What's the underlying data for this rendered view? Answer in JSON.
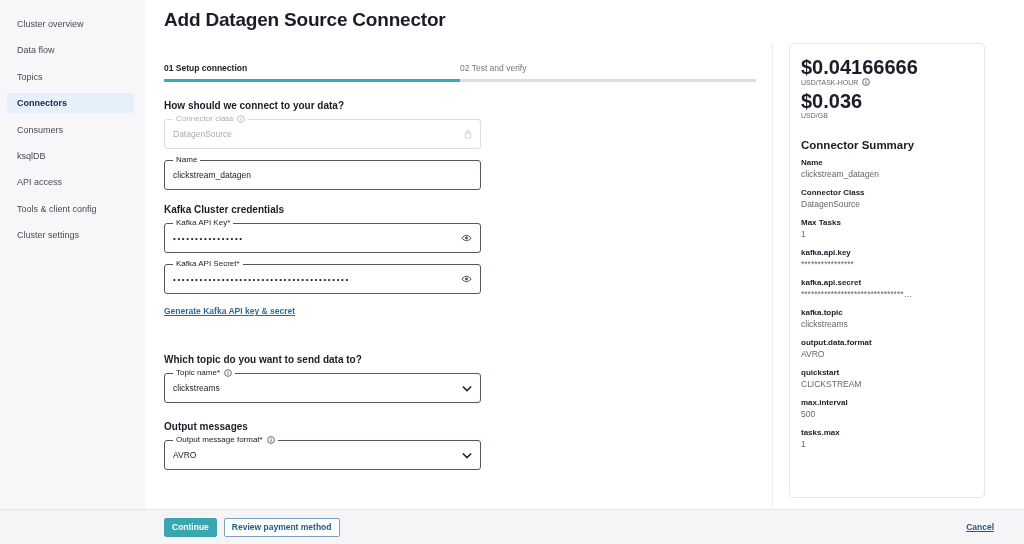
{
  "sidebar": {
    "items": [
      {
        "label": "Cluster overview",
        "selected": false
      },
      {
        "label": "Data flow",
        "selected": false
      },
      {
        "label": "Topics",
        "selected": false
      },
      {
        "label": "Connectors",
        "selected": true
      },
      {
        "label": "Consumers",
        "selected": false
      },
      {
        "label": "ksqlDB",
        "selected": false
      },
      {
        "label": "API access",
        "selected": false
      },
      {
        "label": "Tools & client config",
        "selected": false
      },
      {
        "label": "Cluster settings",
        "selected": false
      }
    ]
  },
  "page": {
    "title": "Add Datagen Source Connector"
  },
  "steps": {
    "items": [
      {
        "label": "01 Setup connection",
        "selected": true
      },
      {
        "label": "02 Test and verify",
        "selected": false
      }
    ],
    "level": 0.5
  },
  "form": {
    "sections": [
      {
        "heading": "How should we connect to your data?",
        "fields": [
          {
            "kind": "disabled",
            "label": "Connector class",
            "info": true,
            "value": "DatagenSource"
          },
          {
            "kind": "text",
            "label": "Name",
            "info": false,
            "value": "clickstream_datagen"
          }
        ]
      },
      {
        "heading": "Kafka Cluster credentials",
        "fields": [
          {
            "kind": "password",
            "label": "Kafka API Key*",
            "info": false,
            "value": "• • • • • • • • • • • • • • • •"
          },
          {
            "kind": "password",
            "label": "Kafka API Secret*",
            "info": false,
            "value": "• • • • • • • • • • • • • • • • • • • • • • • • • • • • • • • • • • • • • • • •"
          }
        ],
        "link": "Generate Kafka API key & secret"
      },
      {
        "heading": "Which topic do you want to send data to?",
        "fields": [
          {
            "kind": "select",
            "label": "Topic name*",
            "info": true,
            "value": "clickstreams"
          }
        ]
      },
      {
        "heading": "Output messages",
        "fields": [
          {
            "kind": "select",
            "label": "Output message format*",
            "info": true,
            "value": "AVRO"
          }
        ]
      }
    ]
  },
  "summary": {
    "prices": [
      {
        "amount": "$0.04166666",
        "unit": "USD/TASK-HOUR",
        "info": true
      },
      {
        "amount": "$0.036",
        "unit": "USD/GB",
        "info": false
      }
    ],
    "title": "Connector Summary",
    "entries": [
      {
        "label": "Name",
        "value": "clickstream_datagen"
      },
      {
        "label": "Connector Class",
        "value": "DatagenSource"
      },
      {
        "label": "Max Tasks",
        "value": "1"
      },
      {
        "label": "kafka.api.key",
        "value": "****************"
      },
      {
        "label": "kafka.api.secret",
        "value": "*******************************…"
      },
      {
        "label": "kafka.topic",
        "value": "clickstreams"
      },
      {
        "label": "output.data.format",
        "value": "AVRO"
      },
      {
        "label": "quickstart",
        "value": "CLICKSTREAM"
      },
      {
        "label": "max.interval",
        "value": "500"
      },
      {
        "label": "tasks.max",
        "value": "1"
      }
    ]
  },
  "footer": {
    "primary": "Continue",
    "secondary": "Review payment method",
    "cancel": "Cancel"
  }
}
